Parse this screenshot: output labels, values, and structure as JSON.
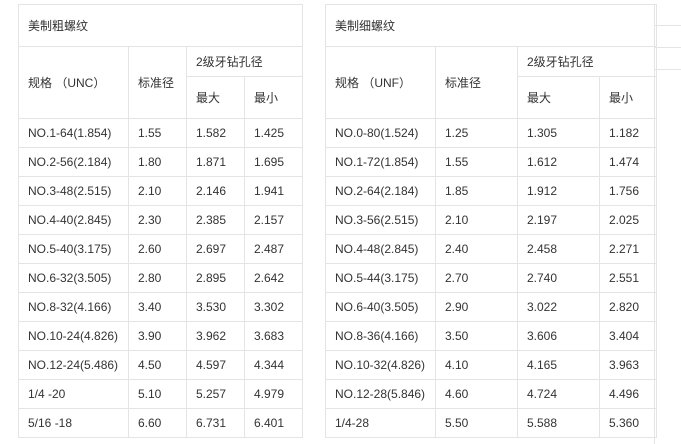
{
  "coarse": {
    "title": "美制粗螺纹",
    "h_spec": "规格 （UNC）",
    "h_nominal": "标准径",
    "h_drill": "2级牙钻孔径",
    "h_max": "最大",
    "h_min": "最小",
    "rows": [
      [
        "NO.1-64(1.854)",
        "1.55",
        "1.582",
        "1.425"
      ],
      [
        "NO.2-56(2.184)",
        "1.80",
        "1.871",
        "1.695"
      ],
      [
        "NO.3-48(2.515)",
        "2.10",
        "2.146",
        "1.941"
      ],
      [
        "NO.4-40(2.845)",
        "2.30",
        "2.385",
        "2.157"
      ],
      [
        "NO.5-40(3.175)",
        "2.60",
        "2.697",
        "2.487"
      ],
      [
        "NO.6-32(3.505)",
        "2.80",
        "2.895",
        "2.642"
      ],
      [
        "NO.8-32(4.166)",
        "3.40",
        "3.530",
        "3.302"
      ],
      [
        "NO.10-24(4.826)",
        "3.90",
        "3.962",
        "3.683"
      ],
      [
        "NO.12-24(5.486)",
        "4.50",
        "4.597",
        "4.344"
      ],
      [
        "1/4 -20",
        "5.10",
        "5.257",
        "4.979"
      ],
      [
        "5/16 -18",
        "6.60",
        "6.731",
        "6.401"
      ]
    ]
  },
  "fine": {
    "title": "美制细螺纹",
    "h_spec": "规格 （UNF）",
    "h_nominal": "标准径",
    "h_drill": "2级牙钻孔径",
    "h_max": "最大",
    "h_min": "最小",
    "rows": [
      [
        "NO.0-80(1.524)",
        "1.25",
        "1.305",
        "1.182"
      ],
      [
        "NO.1-72(1.854)",
        "1.55",
        "1.612",
        "1.474"
      ],
      [
        "NO.2-64(2.184)",
        "1.85",
        "1.912",
        "1.756"
      ],
      [
        "NO.3-56(2.515)",
        "2.10",
        "2.197",
        "2.025"
      ],
      [
        "NO.4-48(2.845)",
        "2.40",
        "2.458",
        "2.271"
      ],
      [
        "NO.5-44(3.175)",
        "2.70",
        "2.740",
        "2.551"
      ],
      [
        "NO.6-40(3.505)",
        "2.90",
        "3.022",
        "2.820"
      ],
      [
        "NO.8-36(4.166)",
        "3.50",
        "3.606",
        "3.404"
      ],
      [
        "NO.10-32(4.826)",
        "4.10",
        "4.165",
        "3.963"
      ],
      [
        "NO.12-28(5.846)",
        "4.60",
        "4.724",
        "4.496"
      ],
      [
        "1/4-28",
        "5.50",
        "5.588",
        "5.360"
      ]
    ]
  }
}
